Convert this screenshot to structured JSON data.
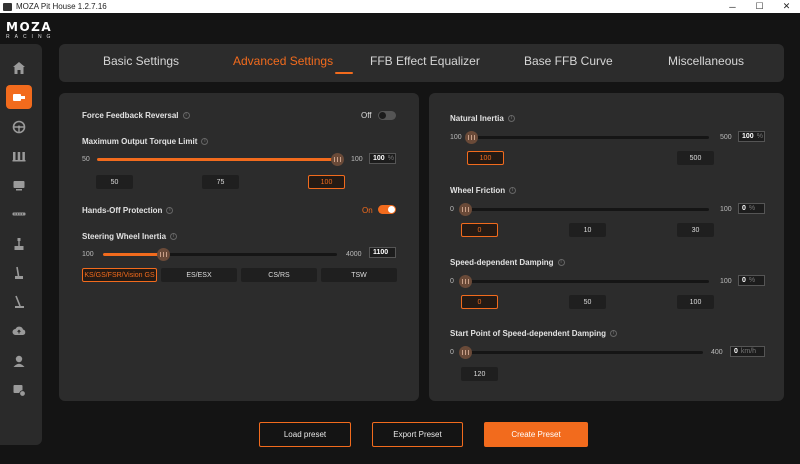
{
  "window": {
    "title": "MOZA Pit House 1.2.7.16",
    "minimize": "─",
    "maximize": "☐",
    "close": "✕"
  },
  "logo": {
    "brand": "MOZA",
    "sub": "RACING"
  },
  "sidebar": {
    "items": [
      {
        "icon": "home-icon"
      },
      {
        "icon": "wheelbase-icon",
        "active": true
      },
      {
        "icon": "steering-wheel-icon"
      },
      {
        "icon": "pedals-icon"
      },
      {
        "icon": "dashboard-icon"
      },
      {
        "icon": "led-bar-icon"
      },
      {
        "icon": "handbrake-icon"
      },
      {
        "icon": "shifter-icon"
      },
      {
        "icon": "sequential-shifter-icon"
      },
      {
        "icon": "cloud-upload-icon"
      },
      {
        "icon": "user-icon"
      },
      {
        "icon": "support-icon"
      }
    ]
  },
  "tabs": [
    {
      "label": "Basic Settings"
    },
    {
      "label": "Advanced Settings",
      "active": true
    },
    {
      "label": "FFB Effect Equalizer"
    },
    {
      "label": "Base FFB Curve"
    },
    {
      "label": "Miscellaneous"
    }
  ],
  "left": {
    "ffb_reversal": {
      "label": "Force Feedback Reversal",
      "state": "Off"
    },
    "torque": {
      "label": "Maximum Output Torque Limit",
      "min": "50",
      "max": "100",
      "value": "100",
      "unit": "%",
      "level": 1.0,
      "presets": [
        "50",
        "75",
        "100"
      ],
      "selected": 2
    },
    "hands_off": {
      "label": "Hands-Off Protection",
      "state": "On"
    },
    "inertia": {
      "label": "Steering Wheel Inertia",
      "min": "100",
      "max": "4000",
      "value": "1100",
      "level": 0.2564,
      "presets": [
        "KS/GS/FSR/Vision GS",
        "ES/ESX",
        "CS/RS",
        "TSW"
      ],
      "selected": 0
    }
  },
  "right": {
    "natural_inertia": {
      "label": "Natural Inertia",
      "min": "100",
      "max": "500",
      "value": "100",
      "unit": "%",
      "level": 0,
      "presets": [
        "100",
        "500"
      ],
      "selected": 0
    },
    "wheel_friction": {
      "label": "Wheel Friction",
      "min": "0",
      "max": "100",
      "value": "0",
      "unit": "%",
      "level": 0,
      "presets": [
        "0",
        "10",
        "30"
      ],
      "selected": 0
    },
    "speed_damping": {
      "label": "Speed-dependent Damping",
      "min": "0",
      "max": "100",
      "value": "0",
      "unit": "%",
      "level": 0,
      "presets": [
        "0",
        "50",
        "100"
      ],
      "selected": 0
    },
    "speed_damping_start": {
      "label": "Start Point of Speed-dependent Damping",
      "min": "0",
      "max": "400",
      "value": "0",
      "unit": "km/h",
      "level": 0,
      "presets": [
        "120"
      ]
    }
  },
  "buttons": {
    "load": "Load preset",
    "export": "Export Preset",
    "create": "Create Preset"
  },
  "colors": {
    "accent": "#f26b1d",
    "panel": "#2c2c2c",
    "background": "#141414"
  }
}
